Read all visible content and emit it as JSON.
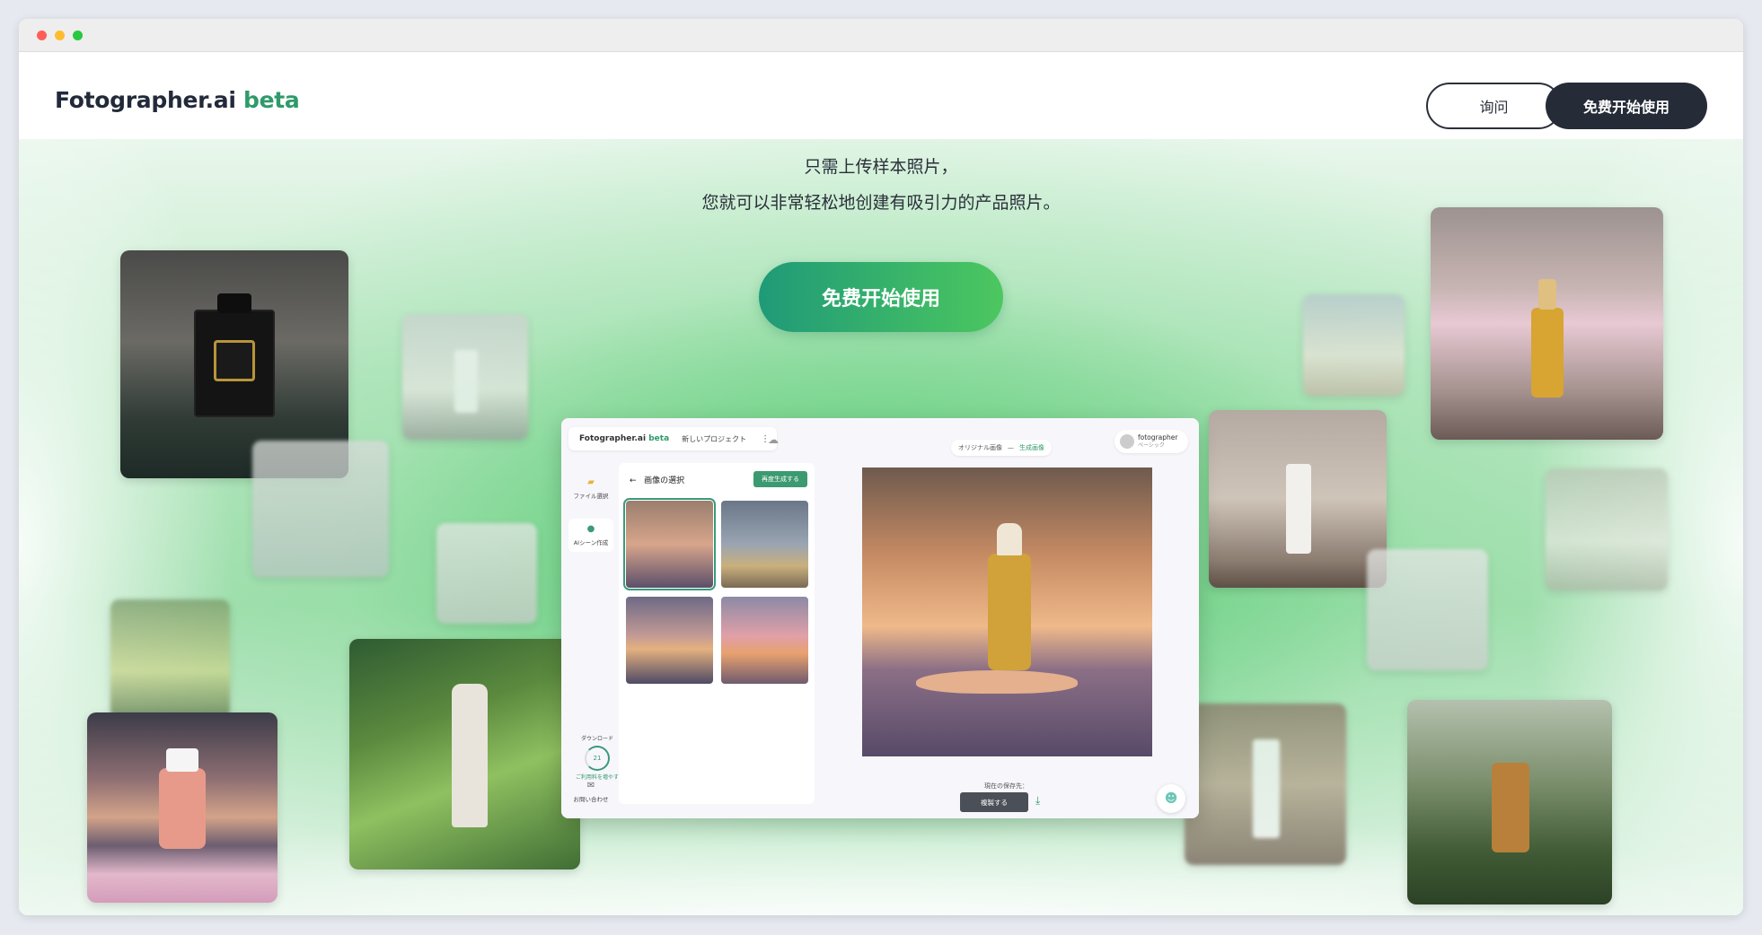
{
  "window": {
    "buttons": [
      "close",
      "minimize",
      "maximize"
    ]
  },
  "header": {
    "logo_text": "Fotographer.ai",
    "logo_beta": "beta",
    "inquiry_label": "询问",
    "free_start_label": "免费开始使用"
  },
  "hero": {
    "line1": "只需上传样本照片，",
    "line2": "您就可以非常轻松地创建有吸引力的产品照片。",
    "cta_label": "免费开始使用"
  },
  "app": {
    "logo_text": "Fotographer.ai",
    "logo_beta": "beta",
    "project_name": "新しいプロジェクト",
    "toggle_original": "オリジナル画像",
    "toggle_generated": "生成画像",
    "user_name": "fotographer",
    "user_plan": "ベーシック",
    "side_file": "ファイル選択",
    "side_scene": "AIシーン作成",
    "panel_title": "画像の選択",
    "regen_label": "再度生成する",
    "download_label": "ダウンロード",
    "download_count": "21",
    "download_total": "60",
    "upgrade_text": "ご利用料を増やす",
    "contact_label": "お問い合わせ",
    "save_label": "現在の保存先：",
    "copy_label": "複製する"
  },
  "colors": {
    "accent": "#2f9a6a",
    "cta_start": "#1f9a78",
    "cta_end": "#4cc75f",
    "header_button_dark": "#262b38"
  },
  "icons": [
    "folder-icon",
    "scene-icon",
    "cloud-icon",
    "download-icon",
    "chatbot-icon",
    "back-arrow-icon",
    "more-icon",
    "contact-icon"
  ]
}
